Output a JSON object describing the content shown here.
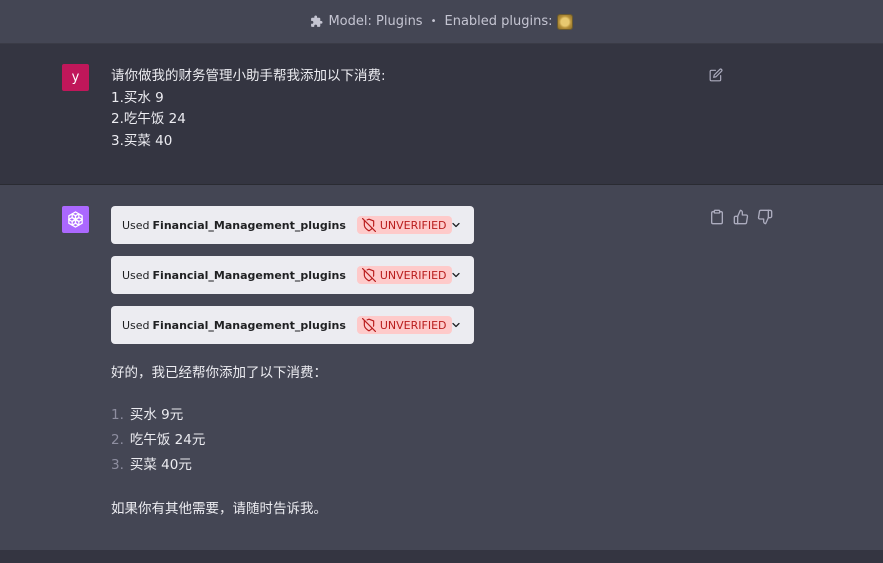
{
  "header": {
    "model_label": "Model: Plugins",
    "separator": "•",
    "enabled_label": "Enabled plugins:",
    "plugin_icon": "financial-plugin-logo"
  },
  "user_message": {
    "avatar_letter": "y",
    "lines": [
      "请你做我的财务管理小助手帮我添加以下消费:",
      "1.买水 9",
      "2.吃午饭 24",
      "3.买菜 40"
    ]
  },
  "assistant_message": {
    "plugin_calls": [
      {
        "used": "Used",
        "name": "Financial_Management_plugins",
        "badge": "UNVERIFIED"
      },
      {
        "used": "Used",
        "name": "Financial_Management_plugins",
        "badge": "UNVERIFIED"
      },
      {
        "used": "Used",
        "name": "Financial_Management_plugins",
        "badge": "UNVERIFIED"
      }
    ],
    "intro": "好的，我已经帮你添加了以下消费：",
    "items": [
      {
        "num": "1.",
        "text": "买水 9元"
      },
      {
        "num": "2.",
        "text": "吃午饭 24元"
      },
      {
        "num": "3.",
        "text": "买菜 40元"
      }
    ],
    "outro": "如果你有其他需要，请随时告诉我。"
  },
  "colors": {
    "user_avatar": "#c0175a",
    "assistant_avatar": "#ab68ff",
    "badge_bg": "#fecaca",
    "badge_text": "#b91c1c"
  }
}
